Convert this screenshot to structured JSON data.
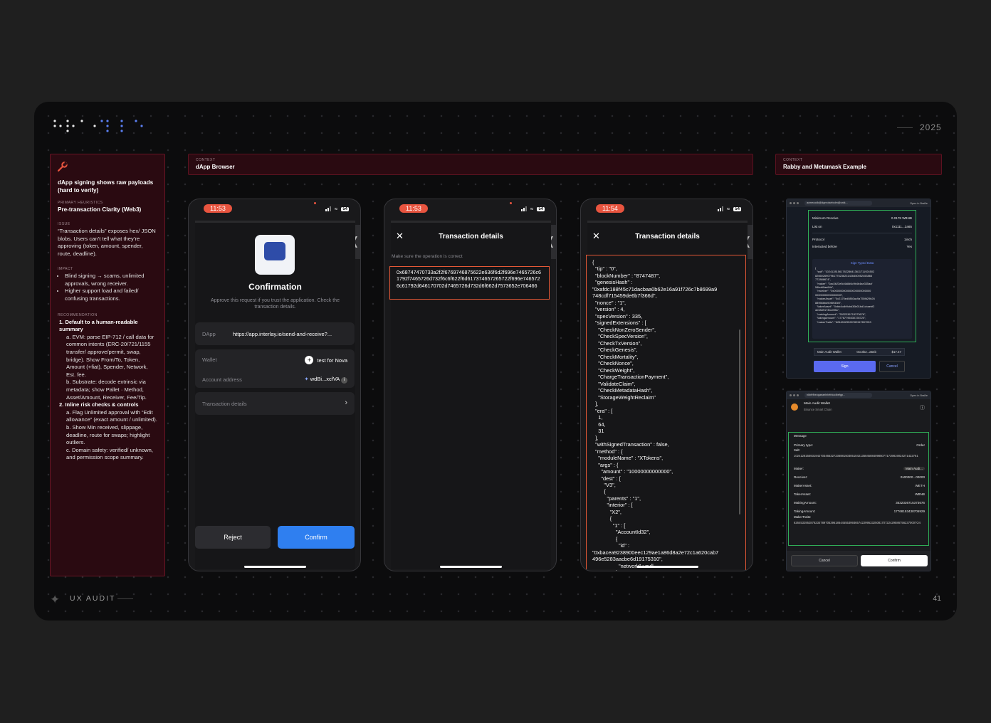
{
  "year": "2025",
  "footer": {
    "label": "UX AUDIT",
    "page": "41"
  },
  "left_card": {
    "title": "dApp signing shows raw payloads (hard to verify)",
    "primary_caption": "PRIMARY HEURISTICS",
    "primary": "Pre-transaction Clarity (Web3)",
    "issue_caption": "ISSUE",
    "issue": "“Transaction details” exposes hex/ JSON blobs. Users can’t tell what they’re approving (token, amount, spender, route, deadline).",
    "impact_caption": "IMPACT",
    "impact": [
      "Blind signing → scams, unlimited approvals, wrong receiver.",
      "Higher support load and failed/ confusing transactions."
    ],
    "rec_caption": "RECOMMENDATION",
    "rec1_title": "1. Default to a human-readable summary",
    "rec1a": "a. EVM: parse EIP-712 / call data for common intents (ERC-20/721/1155 transfer/ approve/permit, swap, bridge). Show From/To, Token, Amount (+fiat), Spender, Network, Est. fee.",
    "rec1b": "b. Substrate: decode extrinsic via metadata; show Pallet · Method, Asset/Amount, Receiver, Fee/Tip.",
    "rec2_title": "2. Inline risk checks & controls",
    "rec2a": "a. Flag Unlimited approval with “Edit allowance” (exact amount / unlimited).",
    "rec2b": "b. Show Min received, slippage, deadline, route for swaps; highlight outliers.",
    "rec2c": "c. Domain safety: verified/ unknown, and permission scope summary."
  },
  "context_dapp": {
    "caption": "CONTEXT",
    "title": "dApp Browser"
  },
  "context_rabby": {
    "caption": "CONTEXT",
    "title": "Rabby and Metamask Example"
  },
  "phone1": {
    "time": "11:53",
    "battery": "54",
    "title": "Confirmation",
    "subtitle": "Approve this request if you trust the application. Check the transaction details.",
    "dapp_label": "DApp",
    "dapp_value": "https://app.interlay.io/send-and-receive?...",
    "wallet_label": "Wallet",
    "wallet_value": "test for Nova",
    "account_label": "Account address",
    "account_value": "wdBi...xcfVA",
    "details_label": "Transaction details",
    "reject": "Reject",
    "confirm": "Confirm"
  },
  "phone2": {
    "time": "11:53",
    "battery": "54",
    "title": "Transaction details",
    "note": "Make sure the operation is correct",
    "hex": "0x68747470733a2f2f6769746875622e636f6d2f696e7465726c61792f7465726d732f6c6f622f6d617374657265722f696e7465726c61792d646170702d7465726d732d6f662d7573652e706466"
  },
  "phone3": {
    "time": "11:54",
    "battery": "54",
    "title": "Transaction details",
    "json": "{\n  \"tip\" : \"0\",\n  \"blockNumber\" : \"8747487\",\n  \"genesisHash\" :\n\"0xafdc188f45c71dacbaa0b62e16a91f726c7b8699a9\n748cdf715459de6b7f366d\",\n  \"nonce\" : \"1\",\n  \"version\" : 4,\n  \"specVersion\" : 335,\n  \"signedExtensions\" : [\n    \"CheckNonZeroSender\",\n    \"CheckSpecVersion\",\n    \"CheckTxVersion\",\n    \"CheckGenesis\",\n    \"CheckMortality\",\n    \"CheckNonce\",\n    \"CheckWeight\",\n    \"ChargeTransactionPayment\",\n    \"ValidateClaim\",\n    \"CheckMetadataHash\",\n    \"StorageWeightReclaim\"\n  ],\n  \"era\" : [\n    1,\n    64,\n    31\n  ],\n  \"withSignedTransaction\" : false,\n  \"method\" : {\n    \"moduleName\" : \"XTokens\",\n    \"args\" : {\n      \"amount\" : \"10000000000000\",\n      \"dest\" : [\n        \"V3\",\n        {\n          \"parents\" : \"1\",\n          \"interior\" : [\n            \"X2\",\n            {\n              \"1\" : [\n                \"AccountId32\",\n                {\n                  \"id\" :\n\"0xbacea9238900eec129ae1a86d8a2e72c1a620cab7\n496e5283aacbe6d19175310\",\n                  \"network\" : null\n                }"
  },
  "rabby": {
    "url": "acmecodk@dgmoisebolm@onlk...",
    "open": "Open in Braille",
    "min_receive_label": "Minimum Receive",
    "min_receive_value": "0.0178 WBNB",
    "list_on_label": "List on",
    "list_on_value": "0x1111...2a65",
    "protocol_label": "Protocol",
    "protocol_value": "1inch",
    "interacted_label": "Interacted before",
    "interacted_value": "Yes",
    "typed_title": "Sign Typed Data",
    "typed_lines": [
      "{",
      "  \"salt\": \"10241281561782286413611711924502",
      "8266026907961775236231426450052453866",
      "772888674\",",
      "  \"maker\": \"0ac3b23e5d4d8d6c9b4b4ae335acf",
      "54bdd0ae64b\",",
      "  \"receiver\": \"0x000000000000000000000000",
      "00000000000000000\",",
      "  \"makerAsset\": \"0x2170ed0880ac9a755fd29b26",
      "88956bbd90f8933f8\",",
      "  \"takerAsset\": \"0xbb4cdb9cbd36b01bd1cbaebf2",
      "de08d9173bc095c\",",
      "  \"makingAmount\": \"3532336715373676\",",
      "  \"takingAmount\": \"17767796530728720\",",
      "  \"makerTraits\": \"62645329528782347897053"
    ],
    "wallet": "Main Audit Wallet",
    "wallet_addr": "0xc3b2...a54b",
    "wallet_balance": "$17.47",
    "sign": "Sign",
    "cancel": "Cancel"
  },
  "metamask": {
    "url": "nkbfrfbeogaeaelelefnkodbefgp...",
    "open": "Open in Braille",
    "wallet": "Main Audit Wallet",
    "chain": "Binance Smart Chain",
    "message": "Message",
    "primary_type_label": "Primary type:",
    "primary_type_value": "Order",
    "salt_label": "Salt:",
    "salt_value": "102412815593194270346532723688150305104213584588409850771739819024271422761",
    "maker_label": "Maker:",
    "maker_value": "Main Audi...",
    "receiver_label": "Receiver:",
    "receiver_value": "0x00000...00000",
    "maker_asset_label": "MakerAsset:",
    "maker_asset_value": "WETH",
    "taker_asset_label": "TakerAsset:",
    "taker_asset_value": "WBNB",
    "making_label": "MakingAmount:",
    "making_value": "3532336715373676",
    "taking_label": "TakingAmount:",
    "taking_value": "17768153438705929",
    "traits_label": "MakerTraits:",
    "traits_value": "62645329528782347897053961864455539936574229953325081707224295867562370007O4",
    "cancel": "Cancel",
    "confirm": "Confirm"
  }
}
